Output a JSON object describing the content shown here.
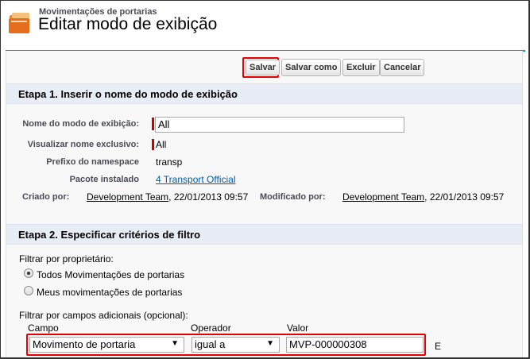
{
  "header": {
    "breadcrumb": "Movimentações de portarias",
    "title": "Editar modo de exibição"
  },
  "toolbar": {
    "save_label": "Salvar",
    "save_as_label": "Salvar como",
    "delete_label": "Excluir",
    "cancel_label": "Cancelar"
  },
  "step1": {
    "title": "Etapa 1. Inserir o nome do modo de exibição",
    "view_name_label": "Nome do modo de exibição:",
    "view_name_value": "All",
    "unique_name_label": "Visualizar nome exclusivo:",
    "unique_name_value": "All",
    "namespace_label": "Prefixo do namespace",
    "namespace_value": "transp",
    "package_label": "Pacote instalado",
    "package_value": "4 Transport Official",
    "created_by_label": "Criado por:",
    "created_by_user": "Development Team",
    "created_by_date": ", 22/01/2013 09:57",
    "modified_by_label": "Modificado por:",
    "modified_by_user": "Development Team",
    "modified_by_date": ", 22/01/2013 09:57"
  },
  "step2": {
    "title": "Etapa 2. Especificar critérios de filtro",
    "owner_filter_label": "Filtrar por proprietário:",
    "option_all": "Todos Movimentações de portarias",
    "option_mine": "Meus movimentações de portarias",
    "additional_label": "Filtrar por campos adicionais (opcional):",
    "col_field": "Campo",
    "col_operator": "Operador",
    "col_value": "Valor",
    "row1_field": "Movimento de portaria",
    "row1_operator": "igual a",
    "row1_value": "MVP-000000308",
    "row1_suffix": "E"
  },
  "colors": {
    "accent": "#1797c0",
    "highlight": "#e60000",
    "required": "#cc0000",
    "section_bg": "#e8ecf5"
  }
}
